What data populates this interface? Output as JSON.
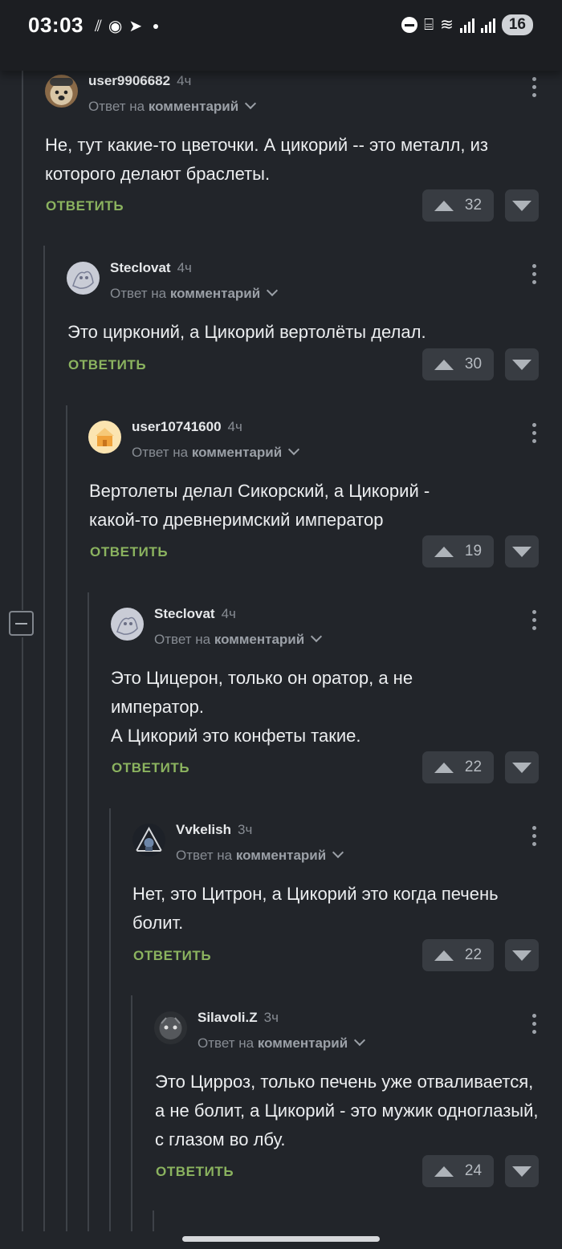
{
  "status_bar": {
    "time": "03:03",
    "battery": "16",
    "left_icons": [
      "stripes-icon",
      "navigator-icon",
      "telegram-icon",
      "notification-dot"
    ],
    "right_icons": [
      "do-not-disturb-icon",
      "sleep-icon",
      "wifi-icon",
      "signal-icon",
      "signal-icon"
    ]
  },
  "colors": {
    "background": "#22252a",
    "reply_link": "#8bb35f",
    "vote_button": "#383c42",
    "muted_text": "#878c93"
  },
  "comments": [
    {
      "username": "user9906682",
      "time": "4ч",
      "reply_prefix": "Ответ на",
      "reply_target": "комментарий",
      "text": "Не, тут какие-то цветочки. А цикорий -- это металл, из которого делают браслеты.",
      "reply_label": "ОТВЕТИТЬ",
      "votes": "32",
      "avatar": "dog-in-cap-avatar",
      "avatar_color": "#8a6a48"
    },
    {
      "username": "Steclovat",
      "time": "4ч",
      "reply_prefix": "Ответ на",
      "reply_target": "комментарий",
      "text": "Это цирконий, а Цикорий вертолёты делал.",
      "reply_label": "ОТВЕТИТЬ",
      "votes": "30",
      "avatar": "sketch-avatar",
      "avatar_color": "#c9ccd6"
    },
    {
      "username": "user10741600",
      "time": "4ч",
      "reply_prefix": "Ответ на",
      "reply_target": "комментарий",
      "text": "Вертолеты делал Сикорский, а Цикорий - какой-то древнеримский император",
      "reply_label": "ОТВЕТИТЬ",
      "votes": "19",
      "avatar": "cartoon-house-avatar",
      "avatar_color": "#f4c46a"
    },
    {
      "username": "Steclovat",
      "time": "4ч",
      "reply_prefix": "Ответ на",
      "reply_target": "комментарий",
      "text": "Это Цицерон, только он оратор, а не император.\nА Цикорий это конфеты такие.",
      "reply_label": "ОТВЕТИТЬ",
      "votes": "22",
      "avatar": "sketch-avatar",
      "avatar_color": "#c9ccd6"
    },
    {
      "username": "Vvkelish",
      "time": "3ч",
      "reply_prefix": "Ответ на",
      "reply_target": "комментарий",
      "text": "Нет, это Цитрон, а Цикорий это когда печень болит.",
      "reply_label": "ОТВЕТИТЬ",
      "votes": "22",
      "avatar": "triangle-robot-avatar",
      "avatar_color": "#5a6f8c"
    },
    {
      "username": "Silavoli.Z",
      "time": "3ч",
      "reply_prefix": "Ответ на",
      "reply_target": "комментарий",
      "text": "Это Цирроз, только печень уже отваливается, а не болит, а Цикорий - это мужик одноглазый, с глазом во лбу.",
      "reply_label": "ОТВЕТИТЬ",
      "votes": "24",
      "avatar": "dark-creature-avatar",
      "avatar_color": "#55585c"
    }
  ]
}
